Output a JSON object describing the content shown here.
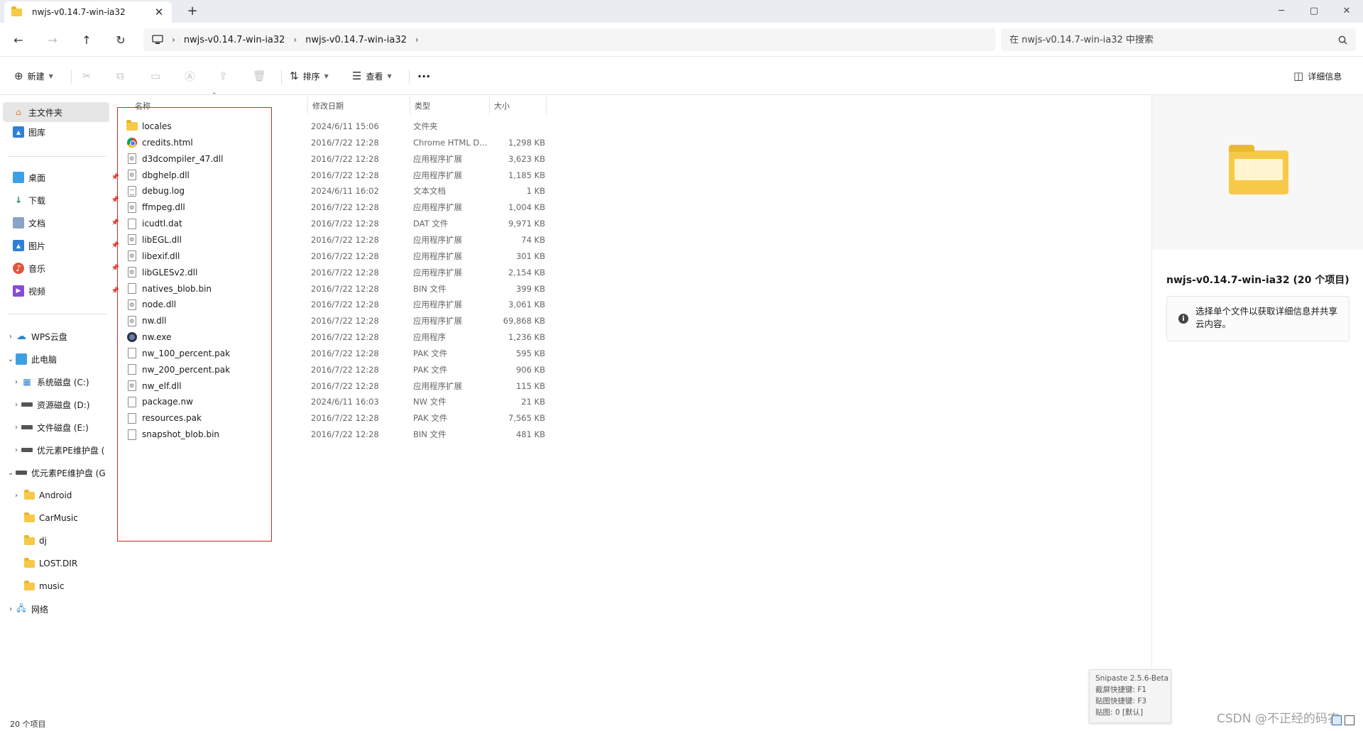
{
  "tab": {
    "title": "nwjs-v0.14.7-win-ia32",
    "close": "✕",
    "new_tab": "+"
  },
  "window_controls": {
    "minimize": "─",
    "maximize": "▢",
    "close": "✕"
  },
  "nav": {
    "back": "←",
    "forward": "→",
    "up": "↑",
    "refresh": "↻"
  },
  "breadcrumb": [
    "nwjs-v0.14.7-win-ia32",
    "nwjs-v0.14.7-win-ia32"
  ],
  "breadcrumb_sep": "›",
  "search": {
    "placeholder": "在 nwjs-v0.14.7-win-ia32 中搜索",
    "icon": "search-icon"
  },
  "commands": {
    "new_label": "新建",
    "sort_label": "排序",
    "view_label": "查看",
    "more_label": "···",
    "details_label": "详细信息"
  },
  "sidebar": {
    "top": [
      {
        "label": "主文件夹",
        "icon": "home-icon",
        "active": true
      },
      {
        "label": "图库",
        "icon": "gallery-icon"
      }
    ],
    "quick": [
      {
        "label": "桌面",
        "icon": "desktop-icon"
      },
      {
        "label": "下载",
        "icon": "download-icon"
      },
      {
        "label": "文档",
        "icon": "documents-icon"
      },
      {
        "label": "图片",
        "icon": "pictures-icon"
      },
      {
        "label": "音乐",
        "icon": "music-icon"
      },
      {
        "label": "视频",
        "icon": "videos-icon"
      }
    ],
    "tree": [
      {
        "label": "WPS云盘",
        "icon": "cloud-icon"
      },
      {
        "label": "此电脑",
        "icon": "pc-icon"
      },
      {
        "label": "系统磁盘 (C:)",
        "icon": "drive-icon"
      },
      {
        "label": "资源磁盘 (D:)",
        "icon": "drive-icon"
      },
      {
        "label": "文件磁盘 (E:)",
        "icon": "drive-icon"
      },
      {
        "label": "优元素PE维护盘 (",
        "icon": "drive-icon"
      },
      {
        "label": "优元素PE维护盘 (G",
        "icon": "drive-icon"
      },
      {
        "label": "Android",
        "icon": "folder-icon"
      },
      {
        "label": "CarMusic",
        "icon": "folder-icon"
      },
      {
        "label": "dj",
        "icon": "folder-icon"
      },
      {
        "label": "LOST.DIR",
        "icon": "folder-icon"
      },
      {
        "label": "music",
        "icon": "folder-icon"
      },
      {
        "label": "网络",
        "icon": "network-icon"
      }
    ]
  },
  "columns": {
    "name": "名称",
    "date": "修改日期",
    "type": "类型",
    "size": "大小"
  },
  "files": [
    {
      "name": "locales",
      "date": "2024/6/11 15:06",
      "type": "文件夹",
      "size": "",
      "icon": "folder"
    },
    {
      "name": "credits.html",
      "date": "2016/7/22 12:28",
      "type": "Chrome HTML D...",
      "size": "1,298 KB",
      "icon": "chrome"
    },
    {
      "name": "d3dcompiler_47.dll",
      "date": "2016/7/22 12:28",
      "type": "应用程序扩展",
      "size": "3,623 KB",
      "icon": "dll"
    },
    {
      "name": "dbghelp.dll",
      "date": "2016/7/22 12:28",
      "type": "应用程序扩展",
      "size": "1,185 KB",
      "icon": "dll"
    },
    {
      "name": "debug.log",
      "date": "2024/6/11 16:02",
      "type": "文本文档",
      "size": "1 KB",
      "icon": "text"
    },
    {
      "name": "ffmpeg.dll",
      "date": "2016/7/22 12:28",
      "type": "应用程序扩展",
      "size": "1,004 KB",
      "icon": "dll"
    },
    {
      "name": "icudtl.dat",
      "date": "2016/7/22 12:28",
      "type": "DAT 文件",
      "size": "9,971 KB",
      "icon": "blank"
    },
    {
      "name": "libEGL.dll",
      "date": "2016/7/22 12:28",
      "type": "应用程序扩展",
      "size": "74 KB",
      "icon": "dll"
    },
    {
      "name": "libexif.dll",
      "date": "2016/7/22 12:28",
      "type": "应用程序扩展",
      "size": "301 KB",
      "icon": "dll"
    },
    {
      "name": "libGLESv2.dll",
      "date": "2016/7/22 12:28",
      "type": "应用程序扩展",
      "size": "2,154 KB",
      "icon": "dll"
    },
    {
      "name": "natives_blob.bin",
      "date": "2016/7/22 12:28",
      "type": "BIN 文件",
      "size": "399 KB",
      "icon": "blank"
    },
    {
      "name": "node.dll",
      "date": "2016/7/22 12:28",
      "type": "应用程序扩展",
      "size": "3,061 KB",
      "icon": "dll"
    },
    {
      "name": "nw.dll",
      "date": "2016/7/22 12:28",
      "type": "应用程序扩展",
      "size": "69,868 KB",
      "icon": "dll"
    },
    {
      "name": "nw.exe",
      "date": "2016/7/22 12:28",
      "type": "应用程序",
      "size": "1,236 KB",
      "icon": "exe"
    },
    {
      "name": "nw_100_percent.pak",
      "date": "2016/7/22 12:28",
      "type": "PAK 文件",
      "size": "595 KB",
      "icon": "blank"
    },
    {
      "name": "nw_200_percent.pak",
      "date": "2016/7/22 12:28",
      "type": "PAK 文件",
      "size": "906 KB",
      "icon": "blank"
    },
    {
      "name": "nw_elf.dll",
      "date": "2016/7/22 12:28",
      "type": "应用程序扩展",
      "size": "115 KB",
      "icon": "dll"
    },
    {
      "name": "package.nw",
      "date": "2024/6/11 16:03",
      "type": "NW 文件",
      "size": "21 KB",
      "icon": "blank"
    },
    {
      "name": "resources.pak",
      "date": "2016/7/22 12:28",
      "type": "PAK 文件",
      "size": "7,565 KB",
      "icon": "blank"
    },
    {
      "name": "snapshot_blob.bin",
      "date": "2016/7/22 12:28",
      "type": "BIN 文件",
      "size": "481 KB",
      "icon": "blank"
    }
  ],
  "details": {
    "title": "nwjs-v0.14.7-win-ia32 (20 个项目)",
    "info": "选择单个文件以获取详细信息并共享云内容。",
    "info_icon": "i"
  },
  "status": {
    "count": "20 个项目"
  },
  "snipaste": {
    "title": "Snipaste 2.5.6-Beta",
    "line1": "截屏快捷键: F1",
    "line2": "贴图快捷键: F3",
    "line3": "贴图: 0 [默认]"
  },
  "watermark": "CSDN @不正经的码农",
  "colors": {
    "accent": "#0067c0",
    "folder": "#f7c948",
    "highlight_box": "#e02020"
  }
}
